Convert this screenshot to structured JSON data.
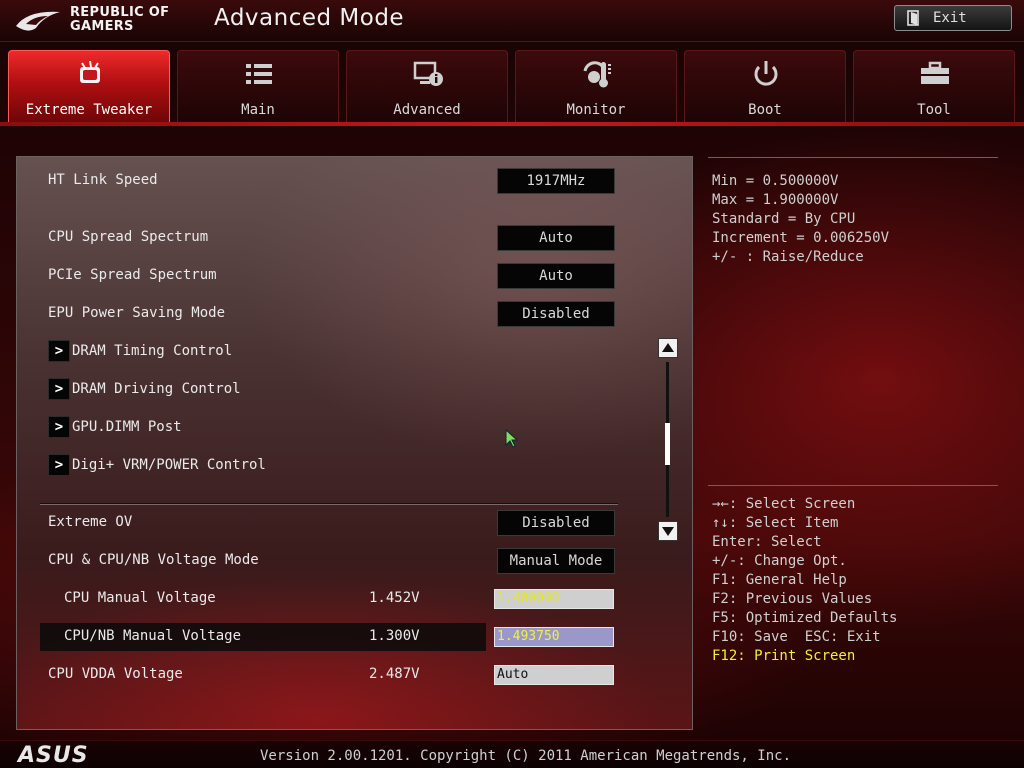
{
  "header": {
    "logo_line1": "REPUBLIC OF",
    "logo_line2": "GAMERS",
    "title": "Advanced Mode",
    "exit_label": "Exit"
  },
  "tabs": [
    {
      "label": "Extreme Tweaker",
      "icon": "tweaker-icon",
      "active": true
    },
    {
      "label": "Main",
      "icon": "list-icon",
      "active": false
    },
    {
      "label": "Advanced",
      "icon": "advanced-icon",
      "active": false
    },
    {
      "label": "Monitor",
      "icon": "monitor-icon",
      "active": false
    },
    {
      "label": "Boot",
      "icon": "power-icon",
      "active": false
    },
    {
      "label": "Tool",
      "icon": "toolbox-icon",
      "active": false
    }
  ],
  "settings": {
    "ht_link_speed": {
      "label": "HT Link Speed",
      "value": "1917MHz"
    },
    "cpu_spread": {
      "label": "CPU Spread Spectrum",
      "value": "Auto"
    },
    "pcie_spread": {
      "label": "PCIe Spread Spectrum",
      "value": "Auto"
    },
    "epu_power": {
      "label": "EPU Power Saving Mode",
      "value": "Disabled"
    },
    "submenus": [
      {
        "arrow": ">",
        "label": "DRAM Timing Control"
      },
      {
        "arrow": ">",
        "label": "DRAM Driving Control"
      },
      {
        "arrow": ">",
        "label": "GPU.DIMM Post"
      },
      {
        "arrow": ">",
        "label": "Digi+ VRM/POWER Control"
      }
    ],
    "extreme_ov": {
      "label": "Extreme OV",
      "value": "Disabled"
    },
    "voltage_mode": {
      "label": "CPU & CPU/NB Voltage Mode",
      "value": "Manual Mode"
    },
    "cpu_manual_voltage": {
      "label": "CPU Manual Voltage",
      "reading": "1.452V",
      "value": "1.400000"
    },
    "cpu_nb_manual_voltage": {
      "label": "CPU/NB Manual Voltage",
      "reading": "1.300V",
      "value": "1.493750"
    },
    "cpu_vdda_voltage": {
      "label": "CPU VDDA Voltage",
      "reading": "2.487V",
      "value": "Auto"
    }
  },
  "info": [
    "Min = 0.500000V",
    "Max = 1.900000V",
    "Standard = By CPU",
    "Increment = 0.006250V",
    "+/- : Raise/Reduce"
  ],
  "help": [
    "→←: Select Screen",
    "↑↓: Select Item",
    "Enter: Select",
    "+/-: Change Opt.",
    "F1: General Help",
    "F2: Previous Values",
    "F5: Optimized Defaults",
    "F10: Save  ESC: Exit",
    "F12: Print Screen"
  ],
  "footer": {
    "brand": "ASUS",
    "version": "Version 2.00.1201. Copyright (C) 2011 American Megatrends, Inc."
  },
  "colors": {
    "accent_red": "#c2181b",
    "help_accent": "#f2ee3a",
    "selected_field": "#9a98c9"
  }
}
